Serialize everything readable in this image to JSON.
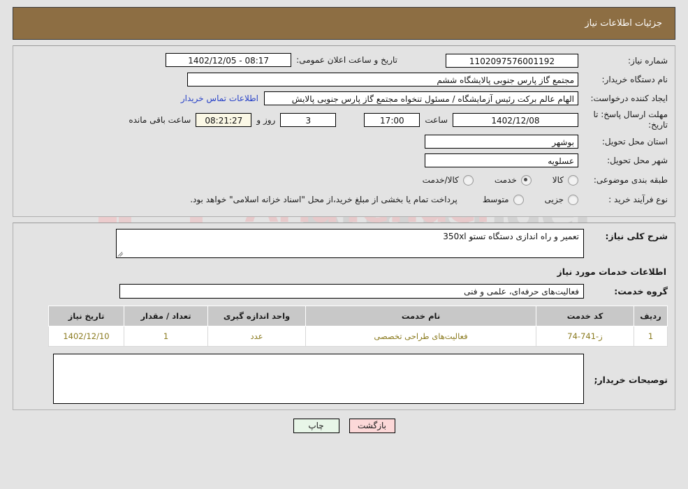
{
  "header": {
    "title": "جزئیات اطلاعات نیاز"
  },
  "watermark": {
    "brand": "AriaTender",
    "suffix": ".net"
  },
  "form": {
    "need_number_label": "شماره نیاز:",
    "need_number_value": "1102097576001192",
    "announce_label": "تاریخ و ساعت اعلان عمومی:",
    "announce_value": "08:17 - 1402/12/05",
    "buyer_org_label": "نام دستگاه خریدار:",
    "buyer_org_value": "مجتمع گاز پارس جنوبی  پالایشگاه ششم",
    "creator_label": "ایجاد کننده درخواست:",
    "creator_value": "الهام عالم برکت رئیس آزمایشگاه / مسئول تنخواه مجتمع گاز پارس جنوبی  پالایش",
    "contact_link": "اطلاعات تماس خریدار",
    "deadline_label": "مهلت ارسال پاسخ: تا تاریخ:",
    "deadline_date": "1402/12/08",
    "hour_label": "ساعت",
    "deadline_time": "17:00",
    "remaining_days": "3",
    "days_and_label": "روز و",
    "remaining_time": "08:21:27",
    "remaining_suffix": "ساعت باقی مانده",
    "province_label": "استان محل تحویل:",
    "province_value": "بوشهر",
    "city_label": "شهر محل تحویل:",
    "city_value": "عسلویه",
    "category_label": "طبقه بندی موضوعی:",
    "category_options": [
      {
        "label": "کالا",
        "selected": false
      },
      {
        "label": "خدمت",
        "selected": true
      },
      {
        "label": "کالا/خدمت",
        "selected": false
      }
    ],
    "process_label": "نوع فرآیند خرید :",
    "process_options": [
      {
        "label": "جزیی",
        "selected": false
      },
      {
        "label": "متوسط",
        "selected": false
      }
    ],
    "process_note": "پرداخت تمام یا بخشی از مبلغ خرید،از محل \"اسناد خزانه اسلامی\" خواهد بود."
  },
  "summary": {
    "label": "شرح کلی نیاز:",
    "value": "تعمیر و راه اندازی دستگاه تستو 350xl"
  },
  "services": {
    "heading": "اطلاعات خدمات مورد نیاز",
    "group_label": "گروه خدمت:",
    "group_value": "فعالیت‌های حرفه‌ای، علمی و فنی",
    "table": {
      "columns": [
        "ردیف",
        "کد خدمت",
        "نام خدمت",
        "واحد اندازه گیری",
        "تعداد / مقدار",
        "تاریخ نیاز"
      ],
      "rows": [
        {
          "index": "1",
          "code": "ز-741-74",
          "name": "فعالیت‌های طراحی تخصصی",
          "unit": "عدد",
          "quantity": "1",
          "date": "1402/12/10"
        }
      ]
    }
  },
  "notes": {
    "label": "توصیحات خریدار;",
    "value": ""
  },
  "buttons": {
    "print": "چاپ",
    "back": "بازگشت"
  }
}
